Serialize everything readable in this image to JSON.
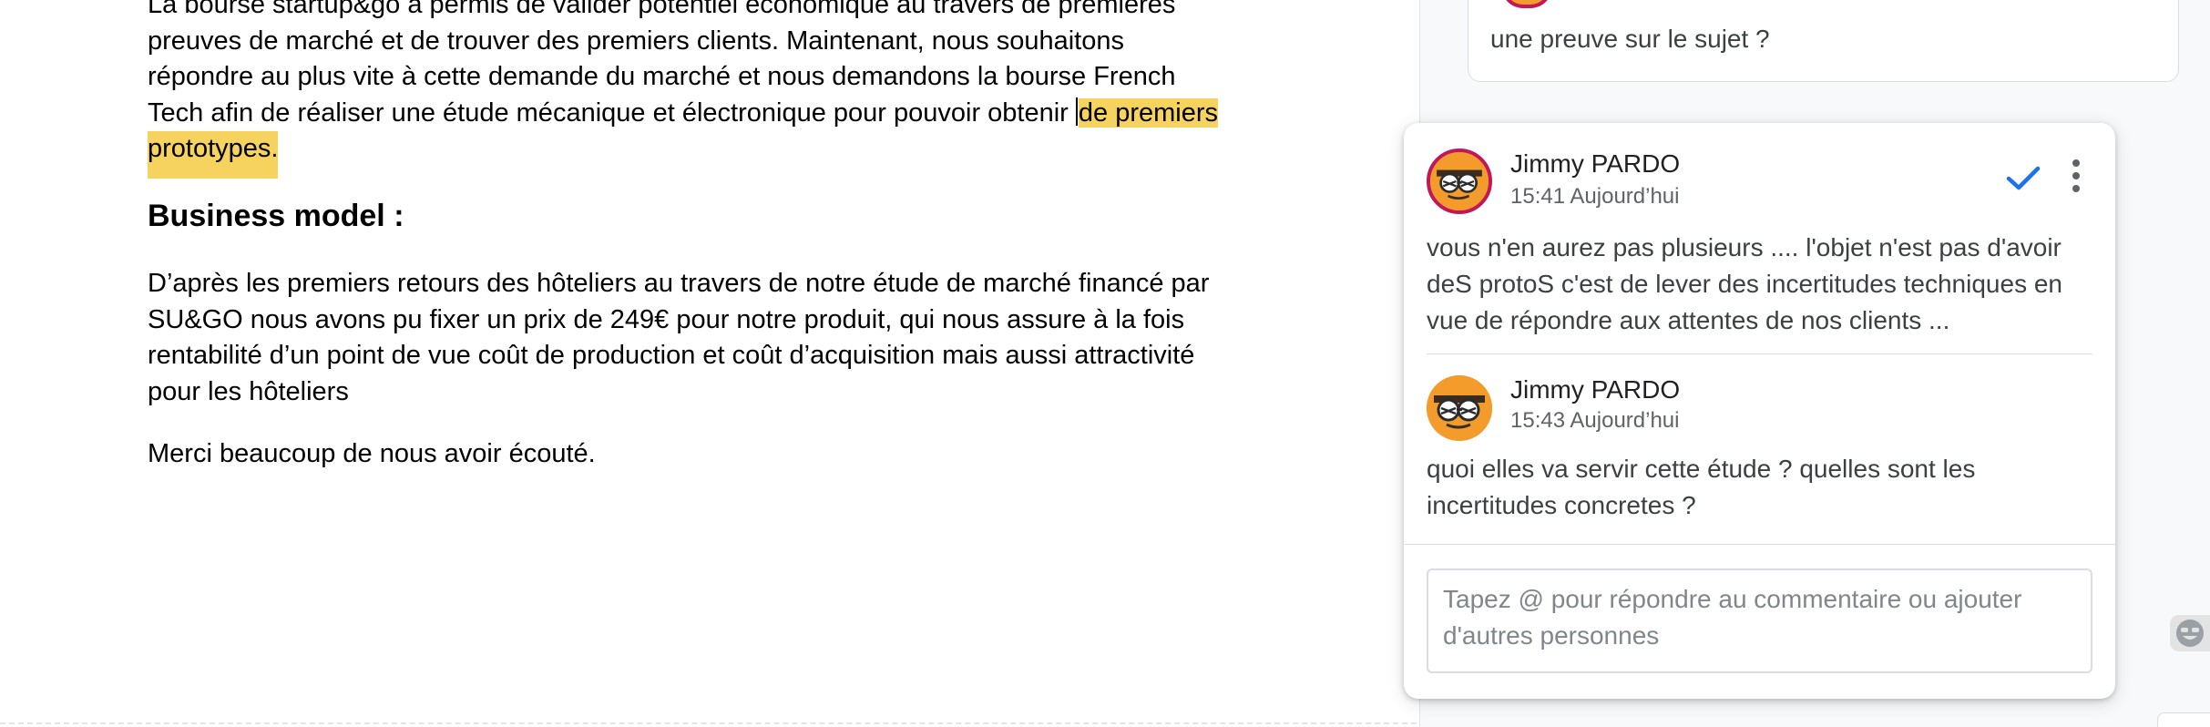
{
  "document": {
    "paragraph1": {
      "line1": "La bourse startup&go a permis de valider potentiel économique au travers de premières",
      "line2": "preuves de marché et de trouver des premiers clients. Maintenant, nous souhaitons",
      "line3": "répondre au plus vite à cette demande du marché et nous demandons la bourse French",
      "line4_plain": "Tech afin de réaliser une étude mécanique et électronique pour pouvoir obtenir ",
      "highlight_part1": "de premiers",
      "highlight_part2": "prototypes."
    },
    "heading": "Business model :",
    "paragraph2": {
      "line1": "D’après les premiers retours des hôteliers au travers de notre étude de marché financé par",
      "line2": "SU&GO nous avons pu fixer un prix de 249€ pour notre produit, qui nous assure à la fois",
      "line3": "rentabilité d’un point de vue coût de production et coût d’acquisition mais aussi attractivité",
      "line4": "pour les hôteliers"
    },
    "paragraph3": "Merci beaucoup de nous avoir écouté.",
    "highlight_color": "#f6d35f"
  },
  "previous_comment": {
    "text": "une preuve sur le sujet ?"
  },
  "comment_thread": {
    "comments": [
      {
        "author": "Jimmy PARDO",
        "time": "15:41 Aujourd’hui",
        "text": "vous n'en aurez pas plusieurs .... l'objet n'est pas d'avoir deS protoS c'est de lever des incertitudes techniques en vue de répondre aux attentes de nos clients ..."
      },
      {
        "author": "Jimmy PARDO",
        "time": "15:43 Aujourd’hui",
        "text": "quoi elles va servir cette étude ? quelles sont les incertitudes concretes ?"
      }
    ],
    "resolve_icon": "check-icon",
    "more_icon": "more-vert-icon",
    "reply_placeholder": "Tapez @ pour répondre au commentaire ou ajouter d'autres personnes",
    "accent_color": "#1a73e8",
    "avatar_ring_color": "#c2185b"
  },
  "emoji_button_icon": "emoji-reaction-icon"
}
